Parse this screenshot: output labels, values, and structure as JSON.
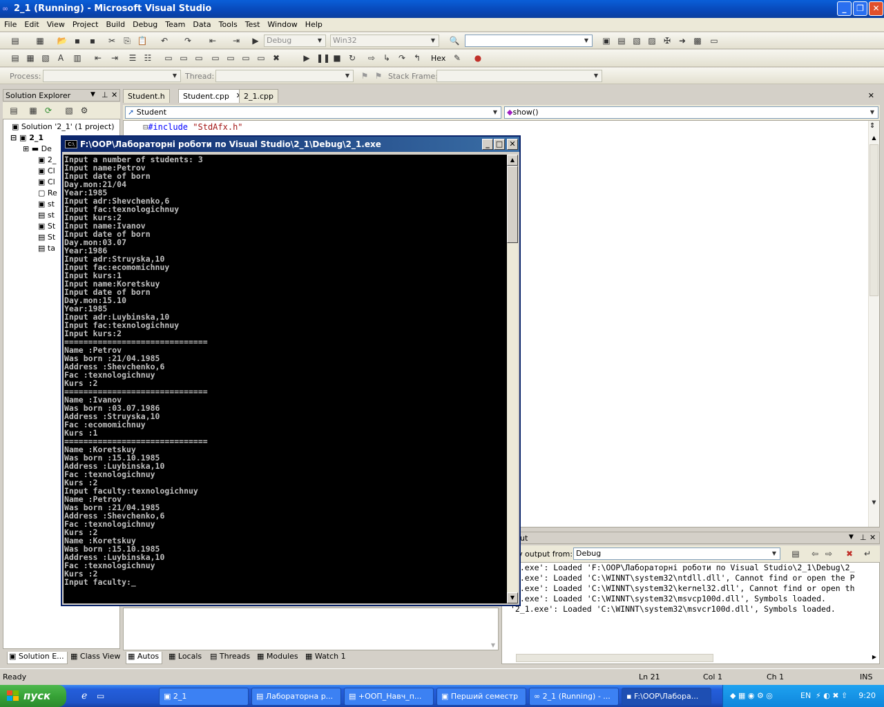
{
  "window": {
    "title": "2_1 (Running) - Microsoft Visual Studio"
  },
  "menu": [
    "File",
    "Edit",
    "View",
    "Project",
    "Build",
    "Debug",
    "Team",
    "Data",
    "Tools",
    "Test",
    "Window",
    "Help"
  ],
  "toolbar": {
    "config": "Debug",
    "platform": "Win32",
    "process_label": "Process:",
    "thread_label": "Thread:",
    "stackframe_label": "Stack Frame:",
    "hex_label": "Hex"
  },
  "solution_explorer": {
    "title": "Solution Explorer",
    "solution": "Solution '2_1' (1 project)",
    "project": "2_1",
    "items": [
      "De",
      "2_",
      "Cl",
      "Cl",
      "Re",
      "st",
      "st",
      "St",
      "St",
      "ta"
    ]
  },
  "editor": {
    "tabs": [
      "Student.h",
      "Student.cpp",
      "2_1.cpp"
    ],
    "active_tab": "Student.cpp",
    "scope": "Student",
    "member": "show()",
    "first_line_kw": "#include",
    "first_line_str": "\"StdAfx.h\""
  },
  "console": {
    "title": "F:\\OOP\\Лабораторні роботи по Visual Studio\\2_1\\Debug\\2_1.exe",
    "lines": [
      "Input a number of students: 3",
      "Input name:Petrov",
      "Input date of born",
      "Day.mon:21/04",
      "Year:1985",
      "Input adr:Shevchenko,6",
      "Input fac:texnologichnuy",
      "Input kurs:2",
      "Input name:Ivanov",
      "Input date of born",
      "Day.mon:03.07",
      "Year:1986",
      "Input adr:Struyska,10",
      "Input fac:ecomomichnuy",
      "Input kurs:1",
      "Input name:Koretskuy",
      "Input date of born",
      "Day.mon:15.10",
      "Year:1985",
      "Input adr:Luybinska,10",
      "Input fac:texnologichnuy",
      "Input kurs:2",
      "==============================",
      "Name :Petrov",
      "Was born :21/04.1985",
      "Address :Shevchenko,6",
      "Fac :texnologichnuy",
      "Kurs :2",
      "==============================",
      "Name :Ivanov",
      "Was born :03.07.1986",
      "Address :Struyska,10",
      "Fac :ecomomichnuy",
      "Kurs :1",
      "==============================",
      "Name :Koretskuy",
      "Was born :15.10.1985",
      "Address :Luybinska,10",
      "Fac :texnologichnuy",
      "Kurs :2",
      "Input faculty:texnologichnuy",
      "Name :Petrov",
      "Was born :21/04.1985",
      "Address :Shevchenko,6",
      "Fac :texnologichnuy",
      "Kurs :2",
      "Name :Koretskuy",
      "Was born :15.10.1985",
      "Address :Luybinska,10",
      "Fac :texnologichnuy",
      "Kurs :2",
      "Input faculty:_"
    ]
  },
  "output": {
    "title": "ut",
    "show_from_label": "v output from:",
    "show_from_value": "Debug",
    "lines": [
      "_1.exe': Loaded 'F:\\OOP\\Лабораторні роботи по Visual Studio\\2_1\\Debug\\2_",
      "_1.exe': Loaded 'C:\\WINNT\\system32\\ntdll.dll', Cannot find or open the P",
      "_1.exe': Loaded 'C:\\WINNT\\system32\\kernel32.dll', Cannot find or open th",
      "_1.exe': Loaded 'C:\\WINNT\\system32\\msvcp100d.dll', Symbols loaded.",
      "'2_1.exe': Loaded 'C:\\WINNT\\system32\\msvcr100d.dll', Symbols loaded."
    ]
  },
  "bottom_tabs": [
    "Autos",
    "Locals",
    "Threads",
    "Modules",
    "Watch 1"
  ],
  "left_tabs": [
    "Solution E...",
    "Class View"
  ],
  "status": {
    "text": "Ready",
    "ln": "Ln 21",
    "col": "Col 1",
    "ch": "Ch 1",
    "mode": "INS"
  },
  "taskbar": {
    "start": "пуск",
    "tasks": [
      "2_1",
      "Лабораторна р...",
      "+ООП_Навч_п...",
      "Перший семестр",
      "2_1 (Running) - ...",
      "F:\\OOP\\Лабора..."
    ],
    "lang": "EN",
    "clock": "9:20"
  }
}
